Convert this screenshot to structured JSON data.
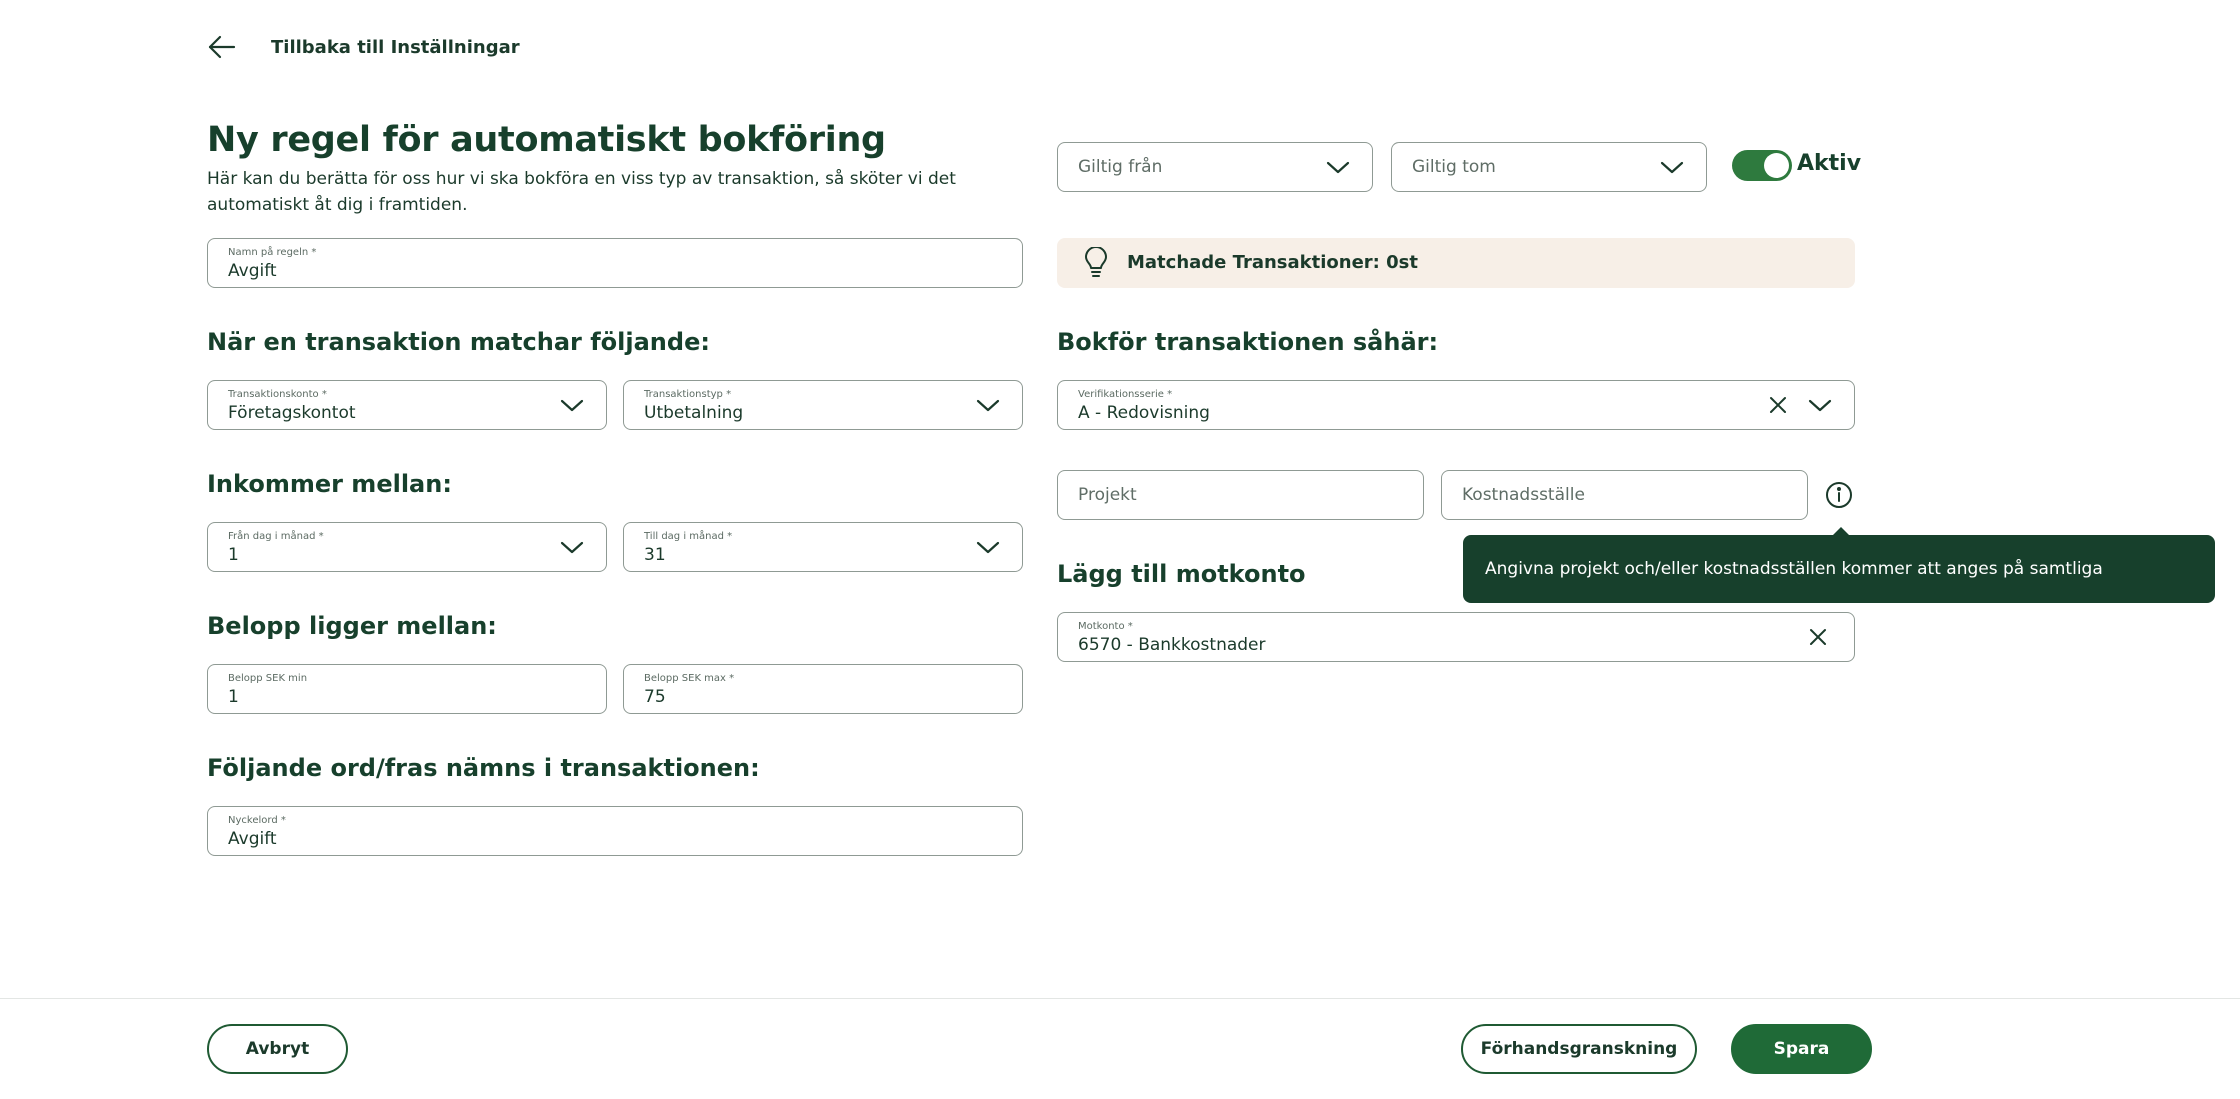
{
  "nav": {
    "back_label": "Tillbaka till Inställningar"
  },
  "header": {
    "title": "Ny regel för automatiskt bokföring",
    "subtitle": "Här kan du berätta för oss hur vi ska bokföra en viss typ av transaktion, så sköter vi det automatiskt åt dig i framtiden."
  },
  "rule_name": {
    "label": "Namn på regeln *",
    "value": "Avgift"
  },
  "validity": {
    "from_placeholder": "Giltig från",
    "to_placeholder": "Giltig tom",
    "active_label": "Aktiv",
    "active": true
  },
  "matched": {
    "text": "Matchade Transaktioner: 0st",
    "icon": "lightbulb-icon"
  },
  "match_section": {
    "heading": "När en transaktion matchar följande:",
    "account": {
      "label": "Transaktionskonto *",
      "value": "Företagskontot"
    },
    "type": {
      "label": "Transaktionstyp *",
      "value": "Utbetalning"
    }
  },
  "incoming_section": {
    "heading": "Inkommer mellan:",
    "from_day": {
      "label": "Från dag i månad *",
      "value": "1"
    },
    "to_day": {
      "label": "Till dag i månad *",
      "value": "31"
    }
  },
  "amount_section": {
    "heading": "Belopp ligger mellan:",
    "min": {
      "label": "Belopp SEK min",
      "value": "1"
    },
    "max": {
      "label": "Belopp SEK max *",
      "value": "75"
    }
  },
  "keyword_section": {
    "heading": "Följande ord/fras nämns i transaktionen:",
    "keyword": {
      "label": "Nyckelord *",
      "value": "Avgift"
    }
  },
  "booking_section": {
    "heading": "Bokför transaktionen såhär:",
    "series": {
      "label": "Verifikationsserie *",
      "value": "A - Redovisning"
    },
    "project_placeholder": "Projekt",
    "cost_center_placeholder": "Kostnadsställe",
    "tooltip": "Angivna projekt och/eller kostnadsställen kommer att anges på samtliga konteringsrader"
  },
  "counter_section": {
    "heading": "Lägg till motkonto",
    "account": {
      "label": "Motkonto *",
      "value": "6570 - Bankkostnader"
    }
  },
  "footer": {
    "cancel_label": "Avbryt",
    "preview_label": "Förhandsgranskning",
    "save_label": "Spara"
  },
  "colors": {
    "primary": "#1f6a37",
    "heading": "#17402c",
    "banner_bg": "#f7efe7",
    "tooltip_bg": "#17402c"
  }
}
